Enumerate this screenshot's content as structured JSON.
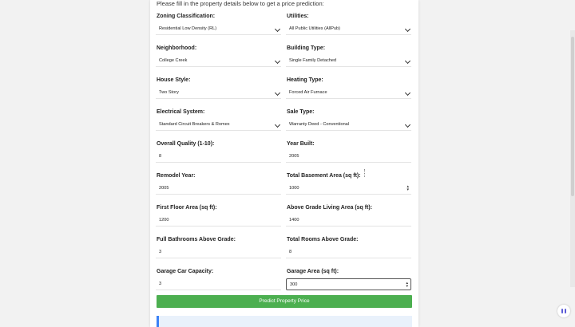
{
  "form": {
    "intro": "Please fill in the property details below to get a price prediction:",
    "rows": [
      {
        "left": {
          "label": "Zoning Classification:",
          "value": "Residential Low Density (RL)",
          "kind": "select"
        },
        "right": {
          "label": "Utilities:",
          "value": "All Public Utilities (AllPub)",
          "kind": "select"
        }
      },
      {
        "left": {
          "label": "Neighborhood:",
          "value": "College Creek",
          "kind": "select"
        },
        "right": {
          "label": "Building Type:",
          "value": "Single Family Detached",
          "kind": "select"
        }
      },
      {
        "left": {
          "label": "House Style:",
          "value": "Two Story",
          "kind": "select"
        },
        "right": {
          "label": "Heating Type:",
          "value": "Forced Air Furnace",
          "kind": "select"
        }
      },
      {
        "left": {
          "label": "Electrical System:",
          "value": "Standard Circuit Breakers & Romex",
          "kind": "select"
        },
        "right": {
          "label": "Sale Type:",
          "value": "Warranty Deed - Conventional",
          "kind": "select"
        }
      },
      {
        "left": {
          "label": "Overall Quality (1-10):",
          "value": "8",
          "kind": "number"
        },
        "right": {
          "label": "Year Built:",
          "value": "2005",
          "kind": "number"
        }
      },
      {
        "left": {
          "label": "Remodel Year:",
          "value": "2005",
          "kind": "number"
        },
        "right": {
          "label": "Total Basement Area (sq ft):",
          "value": "1000",
          "kind": "number"
        }
      },
      {
        "left": {
          "label": "First Floor Area (sq ft):",
          "value": "1200",
          "kind": "number"
        },
        "right": {
          "label": "Above Grade Living Area (sq ft):",
          "value": "1400",
          "kind": "number"
        }
      },
      {
        "left": {
          "label": "Full Bathrooms Above Grade:",
          "value": "3",
          "kind": "number"
        },
        "right": {
          "label": "Total Rooms Above Grade:",
          "value": "8",
          "kind": "number"
        }
      },
      {
        "left": {
          "label": "Garage Car Capacity:",
          "value": "3",
          "kind": "number"
        },
        "right": {
          "label": "Garage Area (sq ft):",
          "value": "300",
          "kind": "number"
        }
      }
    ],
    "submit_label": "Predict Property Price"
  },
  "colors": {
    "accent": "#4caf50",
    "result_border": "#3b82f6",
    "result_bg": "#e9f1fb"
  },
  "icons": {
    "select": "chevron-down-icon",
    "number": "spinner-icon",
    "widget": "assistant-widget-icon"
  }
}
